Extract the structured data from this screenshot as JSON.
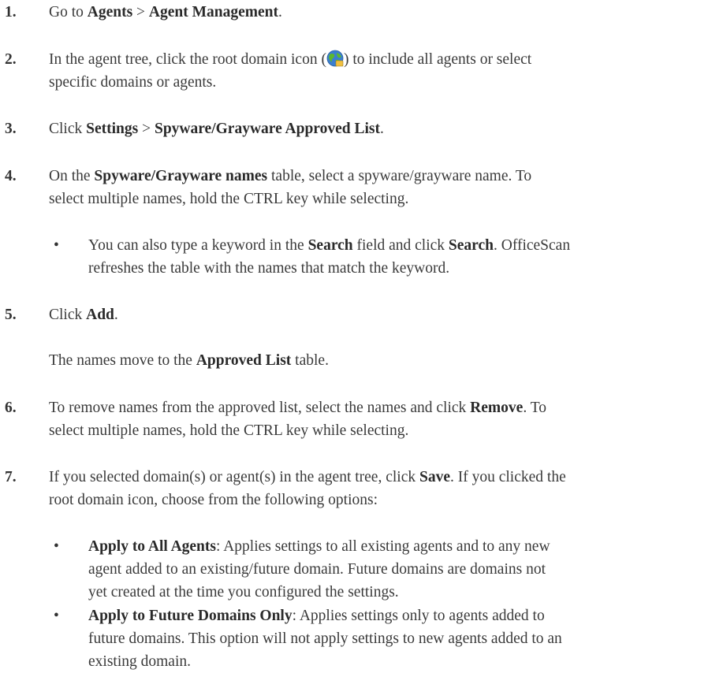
{
  "steps": [
    {
      "num": "1.",
      "p": [
        "Go to ",
        "Agents",
        " > ",
        "Agent Management",
        "."
      ]
    },
    {
      "num": "2.",
      "a": "In the agent tree, click the root domain icon (",
      "b": ") to include all agents or select",
      "c": "specific domains or agents."
    },
    {
      "num": "3.",
      "p": [
        "Click ",
        "Settings",
        " > ",
        "Spyware/Grayware Approved List",
        "."
      ]
    },
    {
      "num": "4.",
      "l1": [
        "On the ",
        "Spyware/Grayware names",
        " table, select a spyware/grayware name. To"
      ],
      "l2": "select multiple names, hold the CTRL key while selecting.",
      "sub": {
        "bullet": "•",
        "l1": [
          "You can also type a keyword in the ",
          "Search",
          " field and click ",
          "Search",
          ". OfficeScan"
        ],
        "l2": "refreshes the table with the names that match the keyword."
      }
    },
    {
      "num": "5.",
      "p": [
        "Click ",
        "Add",
        "."
      ],
      "note": [
        "The names move to the ",
        "Approved List",
        " table."
      ]
    },
    {
      "num": "6.",
      "l1": [
        "To remove names from the approved list, select the names and click ",
        "Remove",
        ". To"
      ],
      "l2": "select multiple names, hold the CTRL key while selecting."
    },
    {
      "num": "7.",
      "l1": [
        "If you selected domain(s) or agent(s) in the agent tree, click ",
        "Save",
        ". If you clicked the"
      ],
      "l2": "root domain icon, choose from the following options:",
      "opts": [
        {
          "bullet": "•",
          "l1": [
            "Apply to All Agents",
            ": Applies settings to all existing agents and to any new"
          ],
          "l2": "agent added to an existing/future domain. Future domains are domains not",
          "l3": "yet created at the time you configured the settings."
        },
        {
          "bullet": "•",
          "l1": [
            "Apply to Future Domains Only",
            ": Applies settings only to agents added to"
          ],
          "l2": "future domains. This option will not apply settings to new agents added to an",
          "l3": "existing domain."
        }
      ]
    }
  ],
  "colors": {
    "text": "#3a3a3a",
    "globe_blue": "#3a7fd0",
    "globe_green": "#5cb82e"
  },
  "icons": {
    "root_domain": "globe-icon"
  }
}
